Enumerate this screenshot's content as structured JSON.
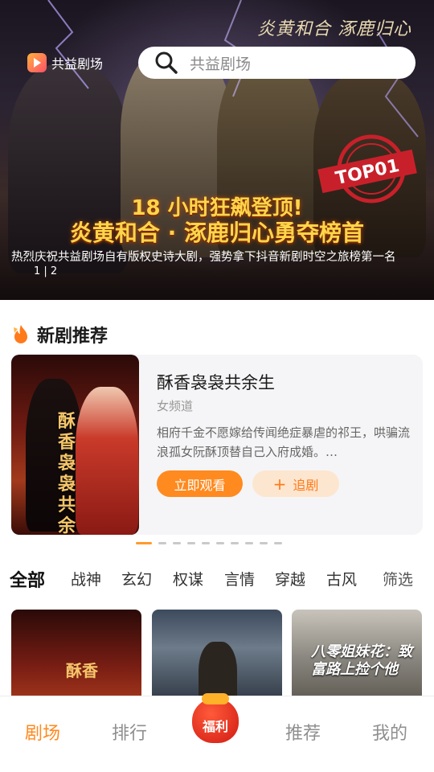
{
  "banner": {
    "calligraphy": "炎黄和合 涿鹿归心",
    "brand_name": "共益剧场",
    "search_placeholder": "共益剧场",
    "badge": "TOP01",
    "headline_1": "18 小时狂飙登顶!",
    "headline_2": "炎黄和合 · 涿鹿归心勇夺榜首",
    "caption": "热烈庆祝共益剧场自有版权史诗大剧，强势拿下抖音新剧时空之旅榜第一名",
    "pager": "1 | 2",
    "icons": [
      "app-logo-icon",
      "search-icon"
    ]
  },
  "section": {
    "title": "新剧推荐",
    "icon": "flame-icon"
  },
  "featured": {
    "poster_title": "酥香袅袅共余生",
    "title": "酥香袅袅共余生",
    "channel": "女频道",
    "description": "相府千金不愿嫁给传闻绝症暴虐的祁王，哄骗流浪孤女阮酥顶替自己入府成婚。…",
    "watch_label": "立即观看",
    "follow_label": "追剧",
    "follow_icon": "plus-icon",
    "carousel_pages": 10,
    "carousel_active": 0
  },
  "tabs": [
    "全部",
    "战神",
    "玄幻",
    "权谋",
    "言情",
    "穿越",
    "古风"
  ],
  "filter_label": "筛选",
  "grid": {
    "item1_text": "酥香",
    "item3_text": "八零姐妹花：致富路上捡个他"
  },
  "nav": {
    "items": [
      "剧场",
      "排行",
      "推荐",
      "我的"
    ],
    "active": "剧场",
    "center_label": "福利",
    "center_icon": "lucky-bag-icon"
  },
  "colors": {
    "accent": "#ff8a1f",
    "accent_light": "#fde6cf",
    "headline": "#ffd54a"
  }
}
